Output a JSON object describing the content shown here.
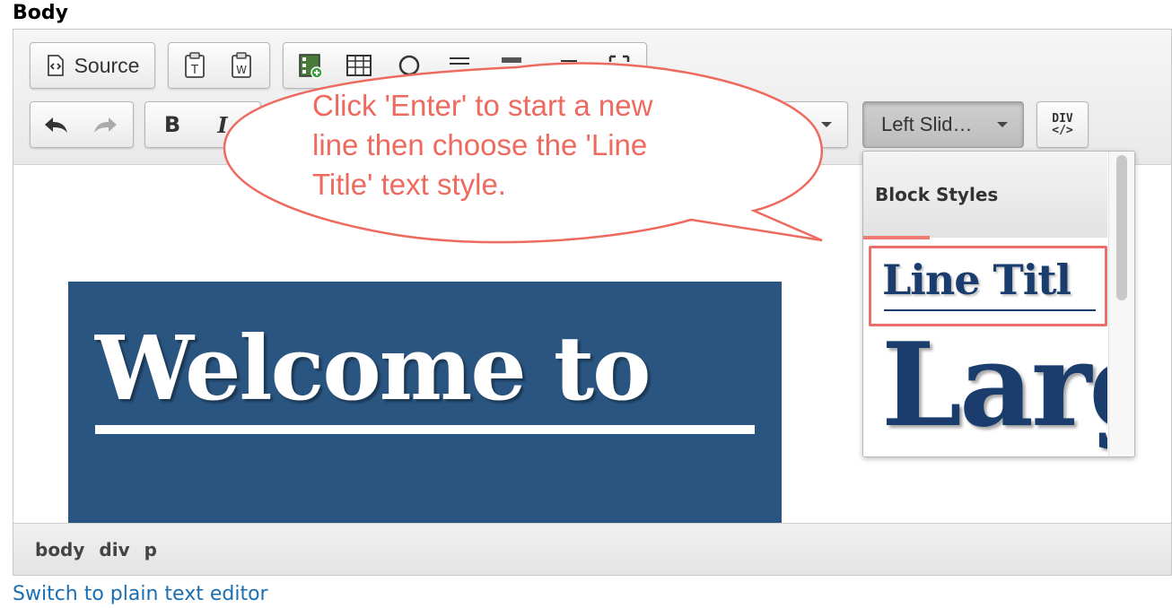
{
  "field": {
    "label": "Body"
  },
  "toolbar": {
    "source_label": "Source",
    "style_combo_value": "Left Slid…",
    "div_label_top": "DIV",
    "div_label_bottom": "</>"
  },
  "dropdown": {
    "header": "Block Styles",
    "options": [
      "Line Titl",
      "Larg"
    ],
    "highlight_color": "#e9706a"
  },
  "content": {
    "hero_title": "Welcome to",
    "hero_bg": "#2a5580"
  },
  "pathbar": {
    "items": [
      "body",
      "div",
      "p"
    ]
  },
  "footer": {
    "switch_link": "Switch to plain text editor"
  },
  "callout": {
    "lines": [
      "Click 'Enter' to start a new",
      "line then choose the 'Line",
      "Title' text style."
    ],
    "color": "#ee6a5f"
  }
}
